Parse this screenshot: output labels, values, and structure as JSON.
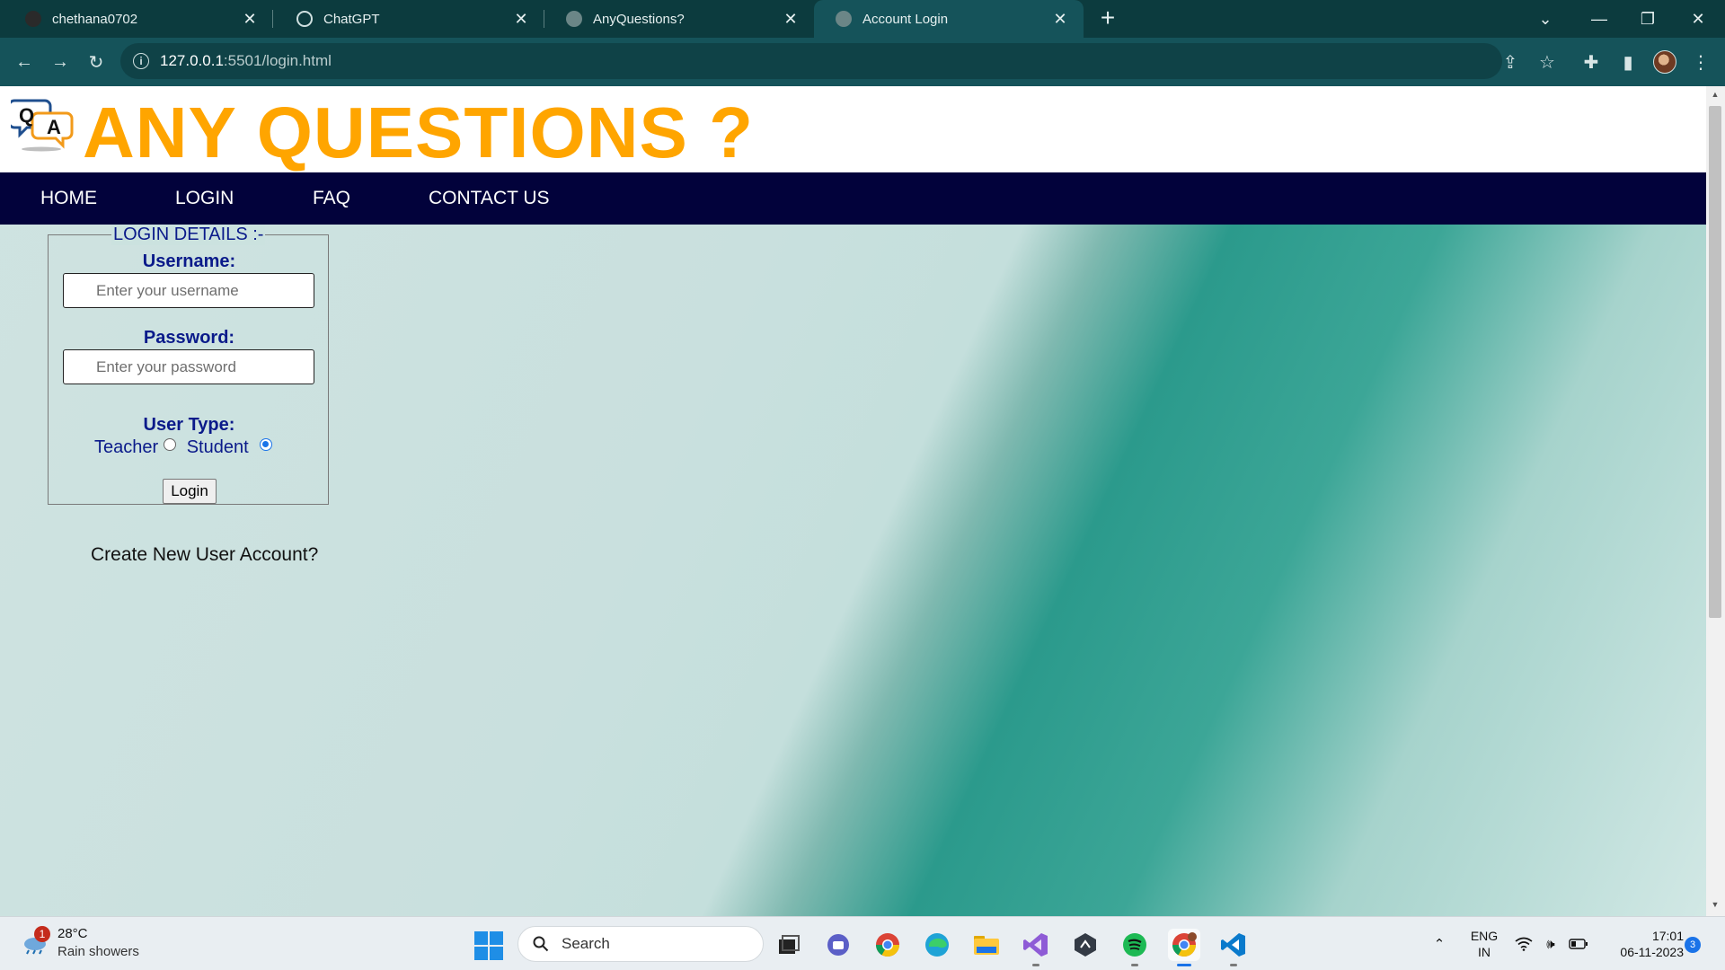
{
  "browser": {
    "tabs": [
      {
        "title": "chethana0702",
        "icon": "github-icon"
      },
      {
        "title": "ChatGPT",
        "icon": "chatgpt-icon"
      },
      {
        "title": "AnyQuestions?",
        "icon": "globe-icon"
      },
      {
        "title": "Account Login",
        "icon": "globe-icon",
        "active": true
      }
    ],
    "url_host": "127.0.0.1",
    "url_path": ":5501/login.html"
  },
  "site": {
    "logo_text": "QA",
    "title": "ANY QUESTIONS ?",
    "title_color": "#ffa500",
    "nav_bg": "#02023b",
    "nav": [
      "HOME",
      "LOGIN",
      "FAQ",
      "CONTACT US"
    ]
  },
  "login": {
    "legend": "LOGIN DETAILS :-",
    "username_label": "Username:",
    "username_placeholder": "Enter your username",
    "password_label": "Password:",
    "password_placeholder": "Enter your password",
    "user_type_label": "User Type:",
    "options": [
      "Teacher",
      "Student"
    ],
    "selected": "Student",
    "button": "Login",
    "create_account": "Create New User Account?"
  },
  "taskbar": {
    "weather_badge": "1",
    "temperature": "28°C",
    "weather_desc": "Rain showers",
    "search_label": "Search",
    "language": [
      "ENG",
      "IN"
    ],
    "time": "17:01",
    "date": "06-11-2023",
    "notification_count": "3"
  }
}
